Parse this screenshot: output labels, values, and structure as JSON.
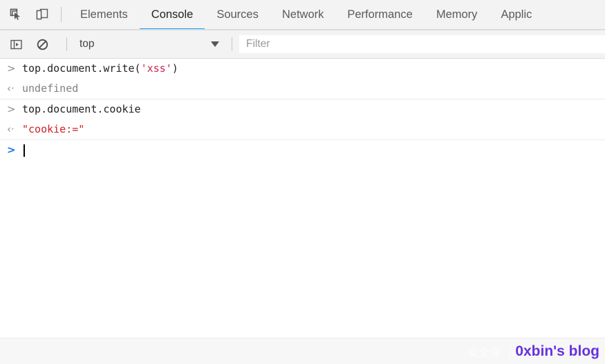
{
  "tabbar": {
    "icons": [
      {
        "name": "inspect-element-icon",
        "label": "Inspect element"
      },
      {
        "name": "device-toolbar-icon",
        "label": "Toggle device toolbar"
      }
    ],
    "tabs": [
      {
        "label": "Elements",
        "active": false
      },
      {
        "label": "Console",
        "active": true
      },
      {
        "label": "Sources",
        "active": false
      },
      {
        "label": "Network",
        "active": false
      },
      {
        "label": "Performance",
        "active": false
      },
      {
        "label": "Memory",
        "active": false
      },
      {
        "label": "Applic",
        "active": false
      }
    ],
    "active_underline_color": "#1aa0ff"
  },
  "console_toolbar": {
    "sidebar_toggle_icon": "console-sidebar-icon",
    "clear_icon": "clear-console-icon",
    "context": {
      "value": "top",
      "caret_icon": "chevron-down-icon"
    },
    "filter": {
      "value": "",
      "placeholder": "Filter"
    }
  },
  "console": {
    "input_arrow": ">",
    "output_arrow": "‹·",
    "prompt_arrow": ">",
    "entries": [
      {
        "type": "input",
        "code_prefix": "top.document.write(",
        "code_string": "'xss'",
        "code_suffix": ")"
      },
      {
        "type": "result",
        "text": "undefined",
        "color": "grey"
      },
      {
        "type": "input",
        "code_prefix": "top.document.cookie",
        "code_string": "",
        "code_suffix": ""
      },
      {
        "type": "result",
        "text": "\"cookie:=\"",
        "color": "red"
      }
    ],
    "string_color": "#c7254e",
    "result_red_color": "#cc2222"
  },
  "footer": {
    "watermark_faint": "安全客（www.",
    "watermark_blog": "0xbin's blog",
    "blog_color": "#6633dd"
  }
}
